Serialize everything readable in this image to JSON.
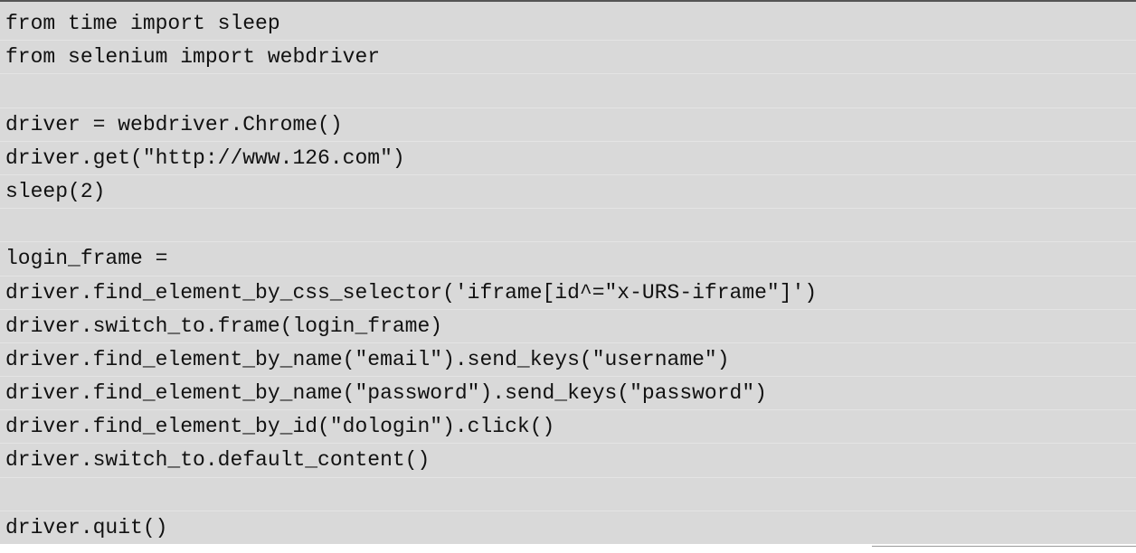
{
  "code": {
    "lines": [
      "from time import sleep",
      "from selenium import webdriver",
      "",
      "driver = webdriver.Chrome()",
      "driver.get(\"http://www.126.com\")",
      "sleep(2)",
      "",
      "login_frame =",
      "driver.find_element_by_css_selector('iframe[id^=\"x-URS-iframe\"]')",
      "driver.switch_to.frame(login_frame)",
      "driver.find_element_by_name(\"email\").send_keys(\"username\")",
      "driver.find_element_by_name(\"password\").send_keys(\"password\")",
      "driver.find_element_by_id(\"dologin\").click()",
      "driver.switch_to.default_content()",
      "",
      "driver.quit()"
    ]
  }
}
